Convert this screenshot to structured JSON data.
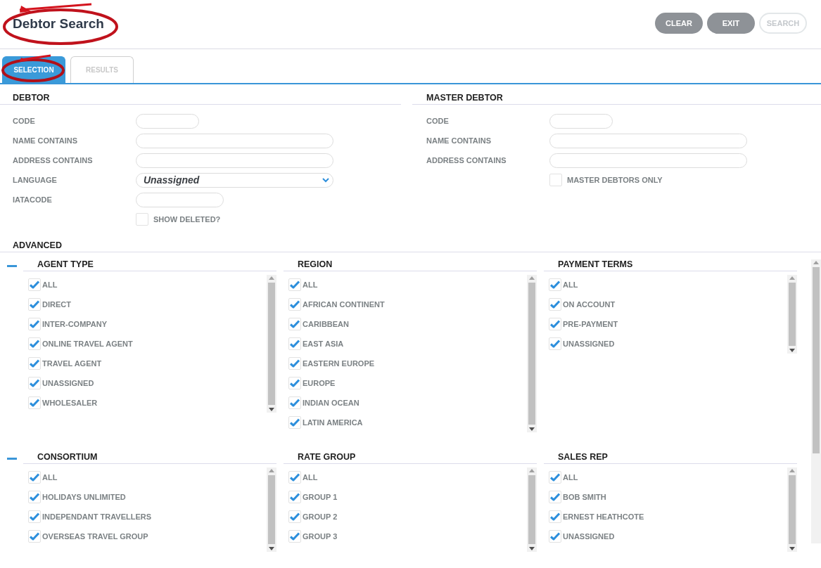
{
  "header": {
    "title": "Debtor Search",
    "buttons": [
      {
        "label": "CLEAR",
        "disabled": false
      },
      {
        "label": "EXIT",
        "disabled": false
      },
      {
        "label": "SEARCH",
        "disabled": true
      }
    ]
  },
  "tabs": [
    {
      "label": "SELECTION",
      "selected": true
    },
    {
      "label": "RESULTS",
      "selected": false
    }
  ],
  "sections": [
    {
      "title": "DEBTOR",
      "fields": [
        {
          "kind": "short",
          "label": "CODE"
        },
        {
          "kind": "long",
          "label": "NAME CONTAINS"
        },
        {
          "kind": "long",
          "label": "ADDRESS CONTAINS"
        },
        {
          "kind": "select",
          "label": "LANGUAGE",
          "value": "Unassigned"
        },
        {
          "kind": "medium",
          "label": "IATACODE"
        },
        {
          "kind": "checkbox",
          "label": "SHOW DELETED?",
          "checked": false
        }
      ]
    },
    {
      "title": "MASTER DEBTOR",
      "fields": [
        {
          "kind": "short",
          "label": "CODE"
        },
        {
          "kind": "long",
          "label": "NAME CONTAINS"
        },
        {
          "kind": "long",
          "label": "ADDRESS CONTAINS"
        },
        {
          "kind": "checkbox",
          "label": "MASTER DEBTORS ONLY",
          "checked": false
        }
      ]
    }
  ],
  "advanced": {
    "title": "ADVANCED",
    "rows": [
      {
        "expanded": true,
        "groups": [
          {
            "title": "AGENT TYPE",
            "items": [
              {
                "label": "ALL",
                "checked": true
              },
              {
                "label": "DIRECT",
                "checked": true
              },
              {
                "label": "INTER-COMPANY",
                "checked": true
              },
              {
                "label": "ONLINE TRAVEL AGENT",
                "checked": true
              },
              {
                "label": "TRAVEL AGENT",
                "checked": true
              },
              {
                "label": "UNASSIGNED",
                "checked": true
              },
              {
                "label": "WHOLESALER",
                "checked": true
              }
            ]
          },
          {
            "title": "REGION",
            "items": [
              {
                "label": "ALL",
                "checked": true
              },
              {
                "label": "AFRICAN CONTINENT",
                "checked": true
              },
              {
                "label": "CARIBBEAN",
                "checked": true
              },
              {
                "label": "EAST ASIA",
                "checked": true
              },
              {
                "label": "EASTERN EUROPE",
                "checked": true
              },
              {
                "label": "EUROPE",
                "checked": true
              },
              {
                "label": "INDIAN OCEAN",
                "checked": true
              },
              {
                "label": "LATIN AMERICA",
                "checked": true
              }
            ]
          },
          {
            "title": "PAYMENT TERMS",
            "items": [
              {
                "label": "ALL",
                "checked": true
              },
              {
                "label": "ON ACCOUNT",
                "checked": true
              },
              {
                "label": "PRE-PAYMENT",
                "checked": true
              },
              {
                "label": "UNASSIGNED",
                "checked": true
              }
            ]
          }
        ]
      },
      {
        "expanded": true,
        "groups": [
          {
            "title": "CONSORTIUM",
            "items": [
              {
                "label": "ALL",
                "checked": true
              },
              {
                "label": "HOLIDAYS UNLIMITED",
                "checked": true
              },
              {
                "label": "INDEPENDANT TRAVELLERS",
                "checked": true
              },
              {
                "label": "OVERSEAS TRAVEL GROUP",
                "checked": true
              }
            ]
          },
          {
            "title": "RATE GROUP",
            "items": [
              {
                "label": "ALL",
                "checked": true
              },
              {
                "label": "GROUP 1",
                "checked": true
              },
              {
                "label": "GROUP 2",
                "checked": true
              },
              {
                "label": "GROUP 3",
                "checked": true
              }
            ]
          },
          {
            "title": "SALES REP",
            "items": [
              {
                "label": "ALL",
                "checked": true
              },
              {
                "label": "BOB SMITH",
                "checked": true
              },
              {
                "label": "ERNEST HEATHCOTE",
                "checked": true
              },
              {
                "label": "UNASSIGNED",
                "checked": true
              }
            ]
          }
        ]
      }
    ]
  }
}
